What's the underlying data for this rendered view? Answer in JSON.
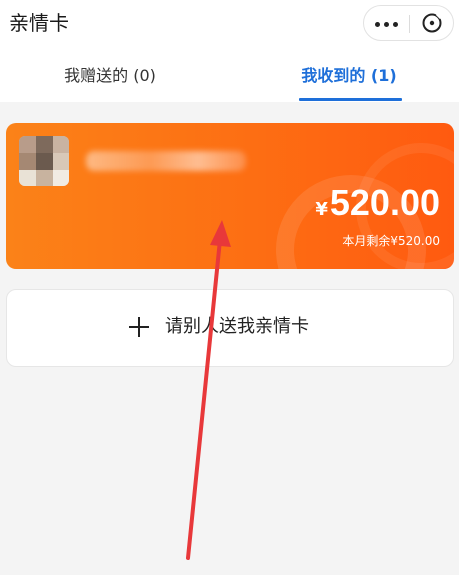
{
  "header": {
    "title": "亲情卡",
    "more_icon": "more-dots-icon",
    "close_icon": "close-circle-icon"
  },
  "tabs": [
    {
      "label": "我赠送的 (0)",
      "active": false
    },
    {
      "label": "我收到的 (1)",
      "active": true
    }
  ],
  "card": {
    "currency": "¥",
    "amount": "520.00",
    "remaining": "本月剩余¥520.00",
    "color_start": "#fb8218",
    "color_end": "#ff5a10"
  },
  "ask": {
    "label": "请别人送我亲情卡",
    "icon": "plus-icon"
  },
  "colors": {
    "accent": "#1e6fd9",
    "annotation_arrow": "#e8383a"
  }
}
